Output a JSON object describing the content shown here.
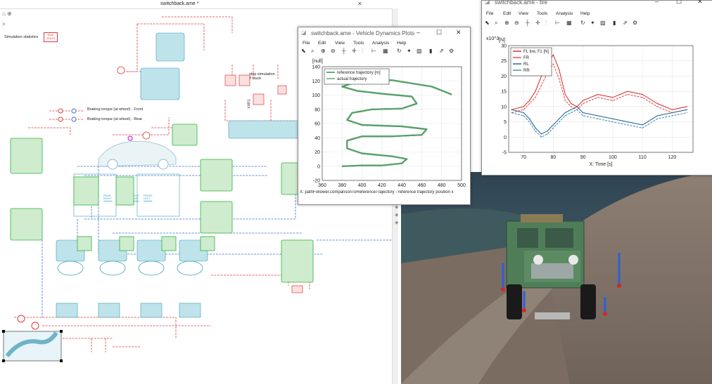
{
  "schematic_window": {
    "title": "switchback.ame *",
    "simulation_statistics": "Simulation statistics",
    "run_stats": "RUN\nSTATS",
    "braking_front": "Braking torque (at wheel) - Front",
    "braking_rear": "Braking torque (at wheel) - Rear",
    "stop_simulation": "stop simulation\nif stuck",
    "wheel_labels": [
      "REAR\nRIGHT\nWHEEL",
      "REAR\nLEFT\nWHEEL",
      "FRONT\nRIGHT\nWHEEL",
      "FRONT\nLEFT\nWHEEL"
    ],
    "vxr_label": "VXR1",
    "colors": {
      "green": "#2db33a",
      "red": "#e03a3a",
      "teal": "#3a9fb5",
      "blue": "#3a6fd6"
    }
  },
  "vehicle_plot_window": {
    "title": "switchback.ame - Vehicle Dynamics Plots",
    "menu": [
      "File",
      "Edit",
      "View",
      "Tools",
      "Analysis",
      "Help"
    ],
    "window_controls": [
      "–",
      "☐",
      "✕"
    ],
    "status_text": "X: pathFollower.comparisonToReferenceTrajectory - reference trajectory position x",
    "chart_data": {
      "type": "line",
      "ylabel": "[null]",
      "xlim": [
        360,
        500
      ],
      "ylim": [
        -20,
        140
      ],
      "x_ticks": [
        360,
        380,
        400,
        420,
        440,
        460,
        480,
        500
      ],
      "y_ticks": [
        -20,
        0,
        20,
        40,
        60,
        80,
        100,
        120,
        140
      ],
      "legend_position": "top-left",
      "grid": true,
      "series": [
        {
          "name": "reference trajectory [m]",
          "color": "#1e8a4a",
          "x": [
            380,
            400,
            420,
            440,
            445,
            430,
            400,
            385,
            385,
            400,
            430,
            460,
            465,
            440,
            400,
            385,
            390,
            410,
            440,
            455,
            450,
            420,
            395,
            380,
            395,
            430,
            470,
            490
          ],
          "y": [
            0,
            1,
            1,
            4,
            10,
            14,
            18,
            25,
            36,
            42,
            42,
            44,
            52,
            56,
            58,
            65,
            75,
            80,
            81,
            88,
            98,
            102,
            106,
            112,
            119,
            121,
            112,
            101
          ]
        },
        {
          "name": "actual trajectory",
          "color": "#5aa06a",
          "x": [
            380,
            400,
            420,
            440,
            445,
            430,
            400,
            385,
            385,
            400,
            430,
            460,
            465,
            440,
            400,
            385,
            390,
            410,
            440,
            455,
            450,
            420,
            395,
            380,
            395,
            430,
            470,
            490
          ],
          "y": [
            0,
            1,
            1,
            4,
            10,
            14,
            18,
            25,
            36,
            42,
            42,
            44,
            52,
            56,
            58,
            65,
            75,
            80,
            81,
            88,
            98,
            102,
            106,
            112,
            119,
            121,
            112,
            101
          ]
        }
      ]
    }
  },
  "tire_plot_window": {
    "title": "switchback.ame - tire",
    "menu": [
      "File",
      "Edit",
      "View",
      "Tools",
      "Analysis",
      "Help"
    ],
    "window_controls": [
      "–",
      "☐",
      "✕"
    ],
    "chart_data": {
      "type": "line",
      "ylabel": "[N]",
      "y_multiplier": "x10^3",
      "xlabel": "X: Time [s]",
      "xlim": [
        65,
        127
      ],
      "ylim": [
        -5,
        30
      ],
      "x_ticks": [
        70,
        80,
        90,
        100,
        110,
        120
      ],
      "y_ticks": [
        -5,
        0,
        5,
        10,
        15,
        20,
        25,
        30
      ],
      "legend_position": "top-left",
      "grid": true,
      "series": [
        {
          "name": "FL tire, Fz [N]",
          "color": "#d62728",
          "x": [
            66,
            70,
            72,
            74,
            76,
            78,
            80,
            82,
            84,
            86,
            88,
            90,
            95,
            100,
            105,
            110,
            115,
            120,
            125
          ],
          "y": [
            9,
            10,
            12,
            15,
            20,
            24,
            27,
            22,
            14,
            11,
            10,
            12,
            14,
            13,
            15,
            14,
            11,
            9,
            10
          ]
        },
        {
          "name": "FR",
          "color": "#e8463c",
          "x": [
            66,
            70,
            72,
            74,
            76,
            78,
            80,
            82,
            84,
            86,
            88,
            90,
            95,
            100,
            105,
            110,
            115,
            120,
            125
          ],
          "y": [
            8,
            9,
            11,
            13,
            17,
            21,
            24,
            19,
            12,
            10,
            9,
            11,
            13,
            12,
            14,
            13,
            10,
            8,
            9
          ]
        },
        {
          "name": "RL",
          "color": "#1f5f8b",
          "x": [
            66,
            70,
            72,
            74,
            76,
            78,
            80,
            82,
            84,
            86,
            88,
            90,
            95,
            100,
            105,
            110,
            115,
            120,
            125
          ],
          "y": [
            9,
            8,
            6,
            3,
            1,
            2,
            4,
            6,
            8,
            9,
            10,
            8,
            7,
            6,
            5,
            4,
            7,
            8,
            9
          ]
        },
        {
          "name": "RR",
          "color": "#3b88b0",
          "x": [
            66,
            70,
            72,
            74,
            76,
            78,
            80,
            82,
            84,
            86,
            88,
            90,
            95,
            100,
            105,
            110,
            115,
            120,
            125
          ],
          "y": [
            8,
            7,
            5,
            2,
            0,
            1,
            3,
            5,
            7,
            8,
            9,
            7,
            6,
            5,
            4,
            3,
            6,
            7,
            8
          ]
        }
      ]
    }
  }
}
